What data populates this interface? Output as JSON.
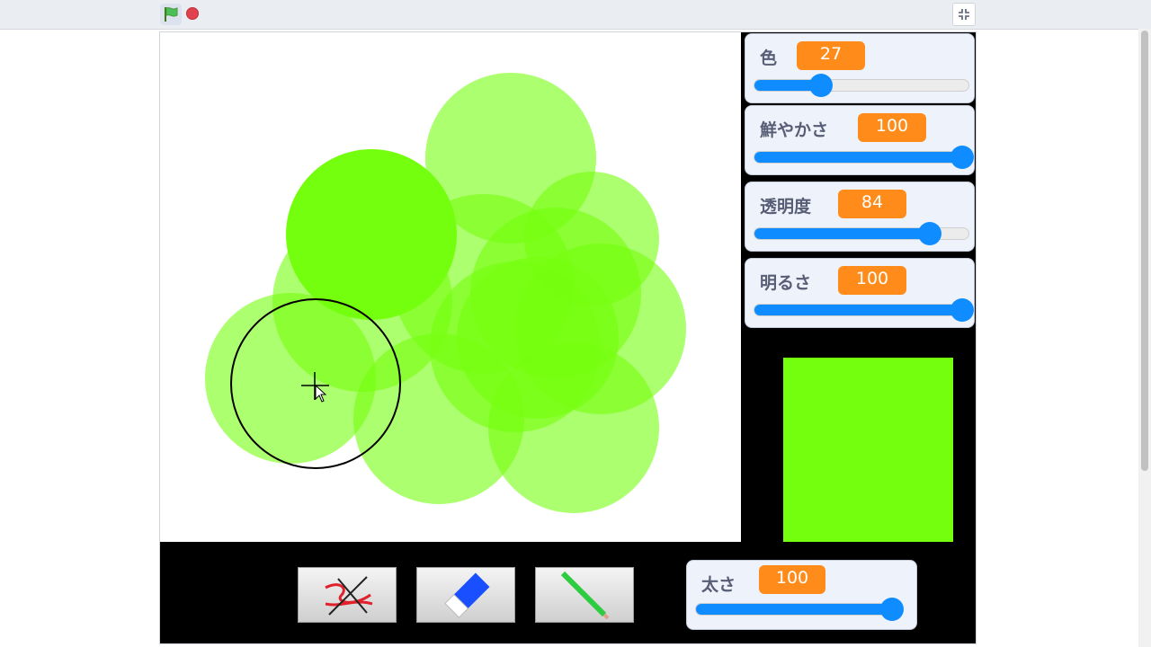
{
  "toolbar": {
    "green_flag_icon": "green-flag-icon",
    "stop_icon": "stop-sign-icon",
    "fullscreen_icon": "exit-fullscreen-icon"
  },
  "sliders": [
    {
      "label": "色",
      "value": "27",
      "level": 0.3
    },
    {
      "label": "鮮やかさ",
      "value": "100",
      "level": 1.0
    },
    {
      "label": "透明度",
      "value": "84",
      "level": 0.84
    },
    {
      "label": "明るさ",
      "value": "100",
      "level": 1.0
    }
  ],
  "thickness": {
    "label": "太さ",
    "value": "100",
    "level": 1.0
  },
  "preview_color": "#74ff0e",
  "tools": [
    {
      "name": "clear-all-tool",
      "icon": "scribble-crossed-icon"
    },
    {
      "name": "eraser-tool",
      "icon": "eraser-icon"
    },
    {
      "name": "pen-tool",
      "icon": "pencil-icon"
    }
  ],
  "colors": {
    "accent": "#0f8cff",
    "badge": "#ff8c1a",
    "paint": "#74ff0e"
  }
}
